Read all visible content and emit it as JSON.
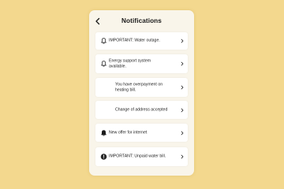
{
  "header": {
    "title": "Notifications",
    "back_icon": "chevron-left-icon"
  },
  "notifications": [
    {
      "text": "IMPORTANT: Water outage.",
      "icon": "bell-icon"
    },
    {
      "text": "Energy support system available.",
      "icon": "bell-icon"
    },
    {
      "text": "You have overpayment on heating bill.",
      "icon": ""
    },
    {
      "text": "Change of address accepted",
      "icon": ""
    },
    {
      "text": "New offer for internet",
      "icon": "bell-icon"
    },
    {
      "text": "IMPORTANT: Unpaid water bill.",
      "icon": "alert-circle-icon"
    }
  ],
  "colors": {
    "background": "#f3d88e",
    "panel": "#f9f5ea",
    "card": "#ffffff",
    "text": "#1a1a1a"
  }
}
